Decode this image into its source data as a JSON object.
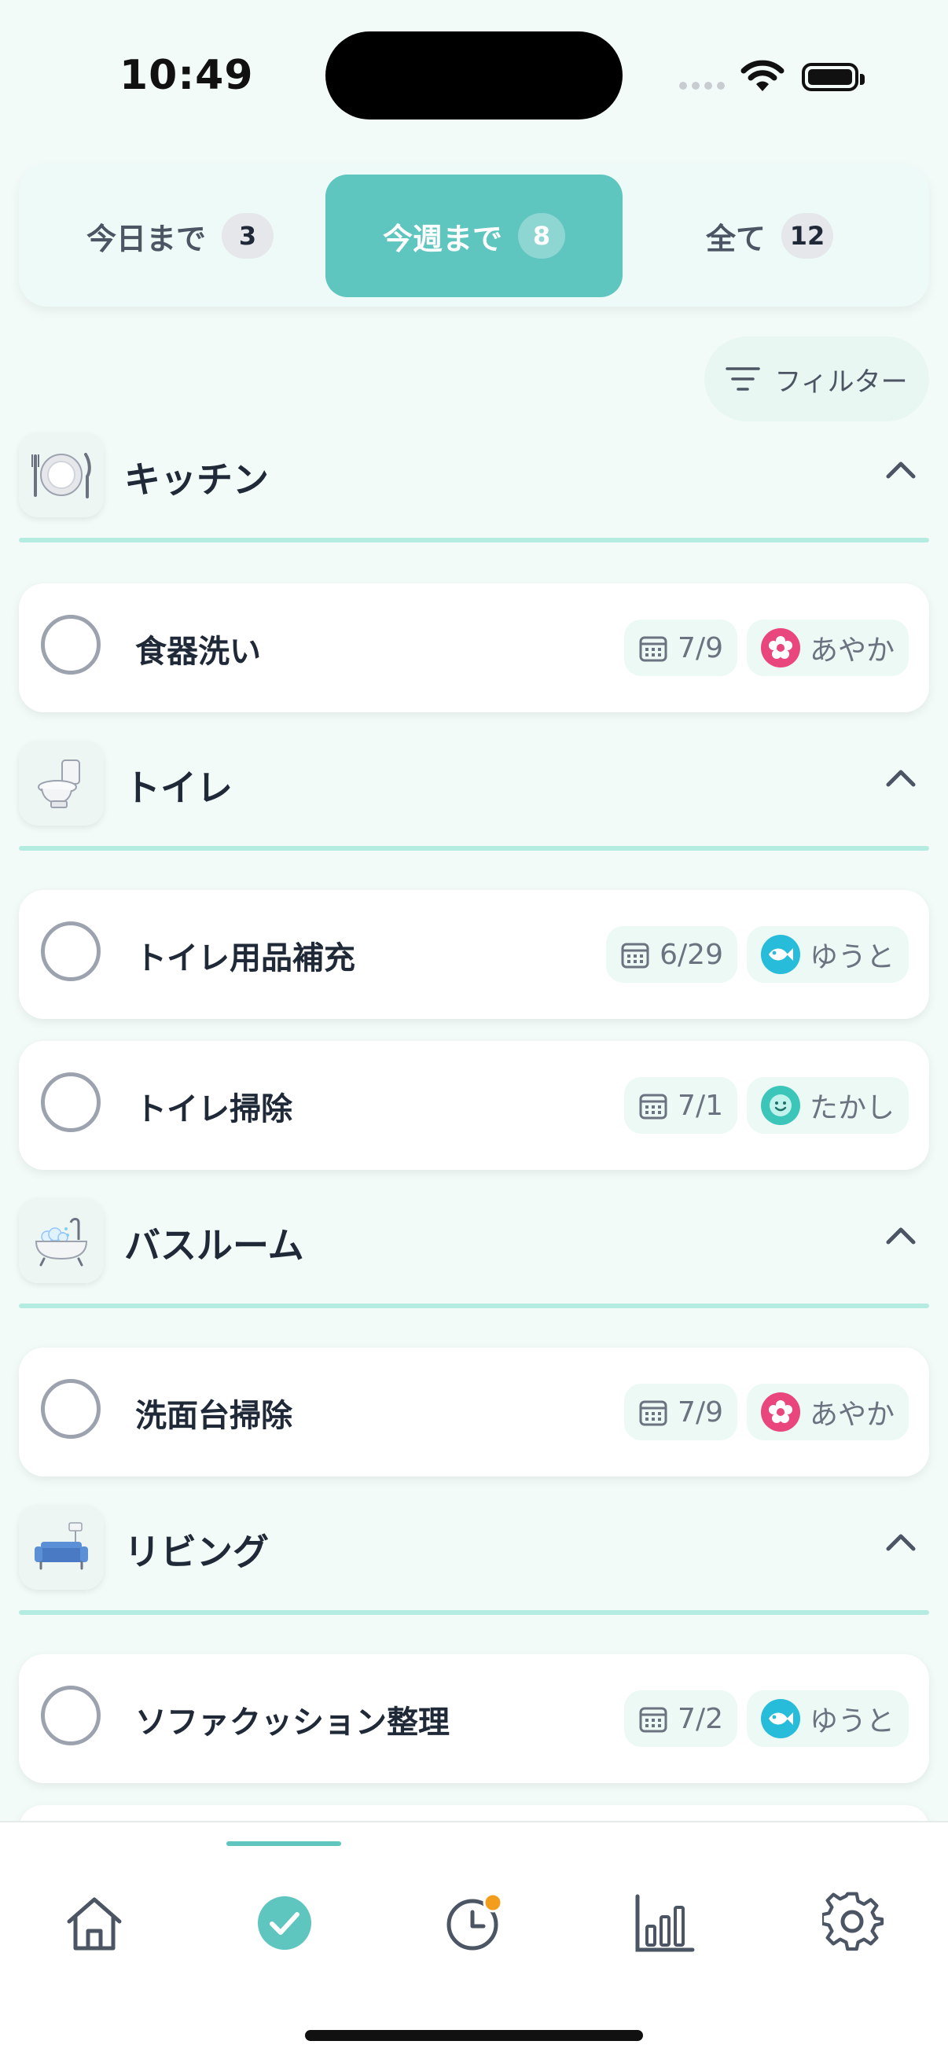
{
  "status": {
    "time": "10:49"
  },
  "tabs": [
    {
      "label": "今日まで",
      "count": "3"
    },
    {
      "label": "今週まで",
      "count": "8",
      "active": true
    },
    {
      "label": "全て",
      "count": "12"
    }
  ],
  "filter": {
    "label": "フィルター"
  },
  "categories": [
    {
      "name": "キッチン",
      "icon": "plate-icon",
      "tasks": [
        {
          "title": "食器洗い",
          "date": "7/9",
          "assignee": "あやか",
          "avatar": "flower-icon",
          "avatar_color": "#e8467c"
        }
      ]
    },
    {
      "name": "トイレ",
      "icon": "toilet-icon",
      "tasks": [
        {
          "title": "トイレ用品補充",
          "date": "6/29",
          "assignee": "ゆうと",
          "avatar": "fish-icon",
          "avatar_color": "#27bcd9"
        },
        {
          "title": "トイレ掃除",
          "date": "7/1",
          "assignee": "たかし",
          "avatar": "smile-icon",
          "avatar_color": "#3cc5b9"
        }
      ]
    },
    {
      "name": "バスルーム",
      "icon": "bathtub-icon",
      "tasks": [
        {
          "title": "洗面台掃除",
          "date": "7/9",
          "assignee": "あやか",
          "avatar": "flower-icon",
          "avatar_color": "#e8467c"
        }
      ]
    },
    {
      "name": "リビング",
      "icon": "couch-icon",
      "tasks": [
        {
          "title": "ソファクッション整理",
          "date": "7/2",
          "assignee": "ゆうと",
          "avatar": "fish-icon",
          "avatar_color": "#27bcd9"
        }
      ]
    }
  ],
  "nav": [
    "home-icon",
    "check-icon",
    "clock-icon",
    "bar-chart-icon",
    "gear-icon"
  ],
  "colors": {
    "accent": "#5ec5bf",
    "rule": "#b5ece1",
    "notification": "#f29d1b"
  }
}
